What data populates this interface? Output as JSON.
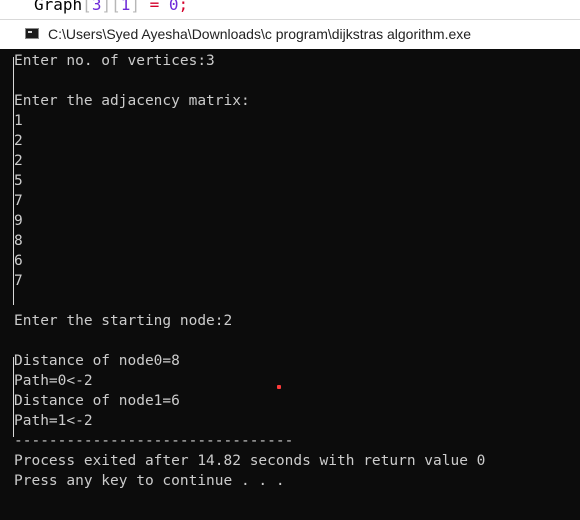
{
  "editor": {
    "code_prefix": "Graph",
    "code_lb1": "[",
    "code_idx1": "3",
    "code_mid": "][",
    "code_idx2": "1",
    "code_rb": "]",
    "code_eq": " = ",
    "code_val": "0",
    "code_semi": ";"
  },
  "window": {
    "title": "C:\\Users\\Syed Ayesha\\Downloads\\c program\\dijkstras algorithm.exe",
    "icon": "console-app-icon"
  },
  "console": {
    "lines": [
      "Enter no. of vertices:3",
      "",
      "Enter the adjacency matrix:",
      "1",
      "2",
      "2",
      "5",
      "7",
      "9",
      "8",
      "6",
      "7",
      "",
      "Enter the starting node:2",
      "",
      "Distance of node0=8",
      "Path=0<-2",
      "Distance of node1=6",
      "Path=1<-2",
      "--------------------------------",
      "Process exited after 14.82 seconds with return value 0",
      "Press any key to continue . . ."
    ]
  }
}
